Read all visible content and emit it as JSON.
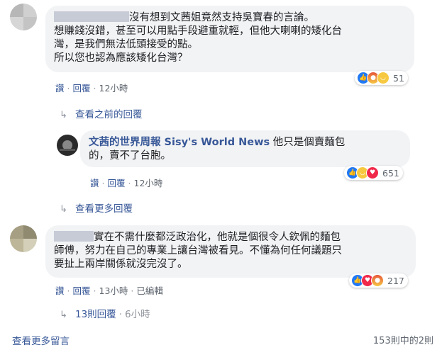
{
  "comment1": {
    "text_line1": "沒有想到文茜姐竟然支持吳寶春的言論。",
    "text_line2": "想賺錢沒錯，甚至可以用點手段避重就輕，但他大喇喇的矮化台",
    "text_line3": "灣，是我們無法低頭接受的點。",
    "text_line4": "所以您也認為應該矮化台灣？",
    "reaction_count": "51",
    "reactions": [
      "like-icon",
      "angry-icon",
      "haha-icon"
    ],
    "actions": {
      "like": "讚",
      "reply": "回覆",
      "time": "12小時"
    }
  },
  "view_previous_replies": "查看之前的回覆",
  "reply1": {
    "author": "文茜的世界周報 Sisy's World News",
    "text_line1": "他只是個賣麵包",
    "text_line2": "的，賣不了台胞。",
    "reaction_count": "651",
    "reactions": [
      "like-icon",
      "haha-icon",
      "love-icon"
    ],
    "actions": {
      "like": "讚",
      "reply": "回覆",
      "time": "12小時"
    }
  },
  "view_more_replies": "查看更多回覆",
  "comment2": {
    "text_line1": "實在不需什麼都泛政治化，他就是個很令人欽佩的麵包",
    "text_line2": "師傅，努力在自己的專業上讓台灣被看見。不懂為何任何議題只",
    "text_line3": "要扯上兩岸關係就沒完沒了。",
    "reaction_count": "217",
    "reactions": [
      "like-icon",
      "love-icon",
      "angry-icon"
    ],
    "actions": {
      "like": "讚",
      "reply": "回覆",
      "time": "13小時",
      "edited": "已編輯"
    }
  },
  "replies_summary": {
    "count": "13則回覆",
    "time": "6小時"
  },
  "footer": {
    "view_more_comments": "查看更多留言",
    "pagination": "153則中的2則"
  }
}
